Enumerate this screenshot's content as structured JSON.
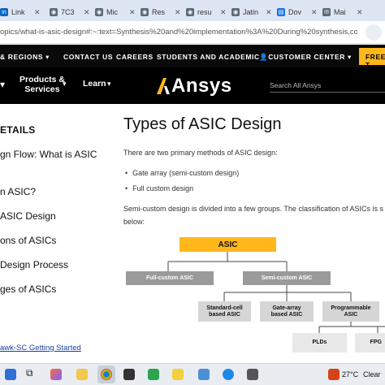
{
  "browser": {
    "tabs": [
      {
        "label": "Link",
        "color": "#0a66c2"
      },
      {
        "label": "7C3",
        "color": "#5a6a7a"
      },
      {
        "label": "Mic",
        "color": "#5a6a7a"
      },
      {
        "label": "Res",
        "color": "#5a6a7a"
      },
      {
        "label": "resu",
        "color": "#5a6a7a"
      },
      {
        "label": "Jatin",
        "color": "#5a6a7a"
      },
      {
        "label": "Dov",
        "color": "#1a73e8"
      },
      {
        "label": "Mai",
        "color": "#5a6a7a"
      }
    ],
    "url": "opics/what-is-asic-design#:~:text=Synthesis%20and%20implementation%3A%20During%20synthesis,consumption%2"
  },
  "topnav": {
    "regions": "& REGIONS",
    "contact": "CONTACT US",
    "careers": "CAREERS",
    "students": "STUDENTS AND ACADEMIC",
    "customer": "CUSTOMER CENTER",
    "free": "FREE T"
  },
  "mainnav": {
    "products": "Products &",
    "services": "Services",
    "learn": "Learn",
    "logo": "Ansys",
    "search_placeholder": "Search All Ansys"
  },
  "sidebar": {
    "heading": "ETAILS",
    "items": [
      "gn Flow: What is ASIC",
      "n ASIC?",
      "ASIC Design",
      "ons of ASICs",
      " Design Process",
      "ges of ASICs"
    ],
    "link": "awk-SC Getting Started"
  },
  "content": {
    "title": "Types of ASIC Design",
    "intro": "There are two primary methods of ASIC design:",
    "methods": [
      "Gate array (semi-custom design)",
      "Full custom design"
    ],
    "para2_line1": "Semi-custom design is divided into a few groups. The classification of ASICs is s",
    "para2_line2": "below:"
  },
  "diagram": {
    "root": "ASIC",
    "full_custom": "Full-custom ASIC",
    "semi_custom": "Semi-custom ASIC",
    "standard_cell": "Standard-cell based ASIC",
    "gate_array": "Gate-array based ASIC",
    "programmable": "Programmable ASIC",
    "plds": "PLDs",
    "fpga": "FPG",
    "colors": {
      "root": "#ffb71b",
      "level1": "#9a9a9a",
      "level2": "#d6d6d6"
    }
  },
  "taskbar": {
    "weather": "27°C",
    "condition": "Clear"
  }
}
